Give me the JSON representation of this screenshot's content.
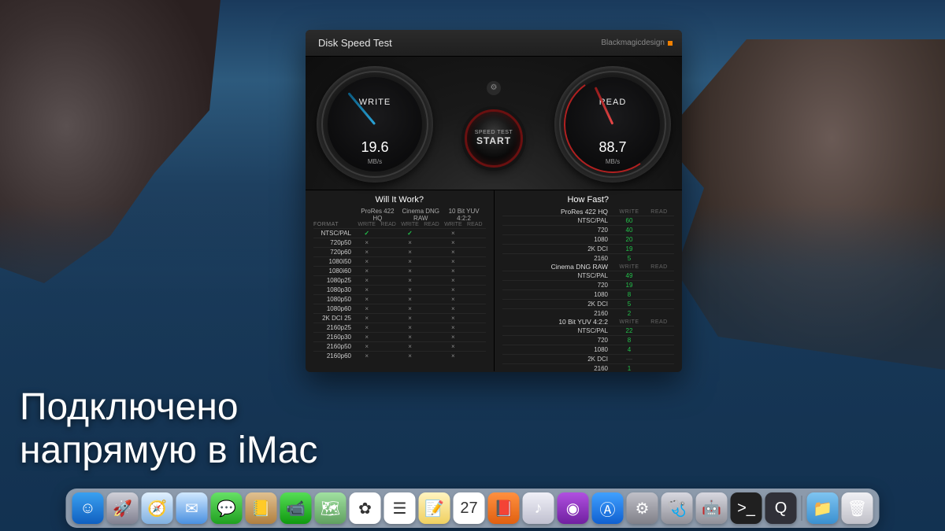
{
  "overlay": {
    "line1": "Подключено",
    "line2": "напрямую в iMac"
  },
  "app": {
    "title": "Disk Speed Test",
    "brand": "Blackmagicdesign",
    "write": {
      "label": "WRITE",
      "value": "19.6",
      "unit": "MB/s"
    },
    "read": {
      "label": "READ",
      "value": "88.7",
      "unit": "MB/s"
    },
    "start": {
      "line1": "SPEED TEST",
      "line2": "START"
    },
    "willItWork": {
      "title": "Will It Work?",
      "formatLabel": "FORMAT",
      "codecs": [
        "ProRes 422 HQ",
        "Cinema DNG RAW",
        "10 Bit YUV 4:2:2"
      ],
      "sub": [
        "WRITE",
        "READ"
      ],
      "rows": [
        {
          "fmt": "NTSC/PAL",
          "cells": [
            "✓",
            "",
            "✓",
            "",
            "×",
            ""
          ]
        },
        {
          "fmt": "720p50",
          "cells": [
            "×",
            "",
            "×",
            "",
            "×",
            ""
          ]
        },
        {
          "fmt": "720p60",
          "cells": [
            "×",
            "",
            "×",
            "",
            "×",
            ""
          ]
        },
        {
          "fmt": "1080i50",
          "cells": [
            "×",
            "",
            "×",
            "",
            "×",
            ""
          ]
        },
        {
          "fmt": "1080i60",
          "cells": [
            "×",
            "",
            "×",
            "",
            "×",
            ""
          ]
        },
        {
          "fmt": "1080p25",
          "cells": [
            "×",
            "",
            "×",
            "",
            "×",
            ""
          ]
        },
        {
          "fmt": "1080p30",
          "cells": [
            "×",
            "",
            "×",
            "",
            "×",
            ""
          ]
        },
        {
          "fmt": "1080p50",
          "cells": [
            "×",
            "",
            "×",
            "",
            "×",
            ""
          ]
        },
        {
          "fmt": "1080p60",
          "cells": [
            "×",
            "",
            "×",
            "",
            "×",
            ""
          ]
        },
        {
          "fmt": "2K DCI 25",
          "cells": [
            "×",
            "",
            "×",
            "",
            "×",
            ""
          ]
        },
        {
          "fmt": "2160p25",
          "cells": [
            "×",
            "",
            "×",
            "",
            "×",
            ""
          ]
        },
        {
          "fmt": "2160p30",
          "cells": [
            "×",
            "",
            "×",
            "",
            "×",
            ""
          ]
        },
        {
          "fmt": "2160p50",
          "cells": [
            "×",
            "",
            "×",
            "",
            "×",
            ""
          ]
        },
        {
          "fmt": "2160p60",
          "cells": [
            "×",
            "",
            "×",
            "",
            "×",
            ""
          ]
        }
      ]
    },
    "howFast": {
      "title": "How Fast?",
      "sub": [
        "WRITE",
        "READ"
      ],
      "groups": [
        {
          "codec": "ProRes 422 HQ",
          "rows": [
            {
              "fmt": "NTSC/PAL",
              "w": "60",
              "r": ""
            },
            {
              "fmt": "720",
              "w": "40",
              "r": ""
            },
            {
              "fmt": "1080",
              "w": "20",
              "r": ""
            },
            {
              "fmt": "2K DCI",
              "w": "19",
              "r": ""
            },
            {
              "fmt": "2160",
              "w": "5",
              "r": ""
            }
          ]
        },
        {
          "codec": "Cinema DNG RAW",
          "rows": [
            {
              "fmt": "NTSC/PAL",
              "w": "49",
              "r": ""
            },
            {
              "fmt": "720",
              "w": "19",
              "r": ""
            },
            {
              "fmt": "1080",
              "w": "8",
              "r": ""
            },
            {
              "fmt": "2K DCI",
              "w": "5",
              "r": ""
            },
            {
              "fmt": "2160",
              "w": "2",
              "r": ""
            }
          ]
        },
        {
          "codec": "10 Bit YUV 4:2:2",
          "rows": [
            {
              "fmt": "NTSC/PAL",
              "w": "22",
              "r": ""
            },
            {
              "fmt": "720",
              "w": "8",
              "r": ""
            },
            {
              "fmt": "1080",
              "w": "4",
              "r": ""
            },
            {
              "fmt": "2K DCI",
              "w": "—",
              "r": ""
            },
            {
              "fmt": "2160",
              "w": "1",
              "r": ""
            }
          ]
        }
      ]
    }
  },
  "dock": {
    "items": [
      {
        "name": "finder",
        "bg": "linear-gradient(#3aa0f0,#1060c0)",
        "glyph": "☺"
      },
      {
        "name": "launchpad",
        "bg": "linear-gradient(#d0d0d8,#808090)",
        "glyph": "🚀"
      },
      {
        "name": "safari",
        "bg": "linear-gradient(#e0f0ff,#80b0e0)",
        "glyph": "🧭"
      },
      {
        "name": "mail",
        "bg": "linear-gradient(#d0e8ff,#4a90e0)",
        "glyph": "✉"
      },
      {
        "name": "messages",
        "bg": "linear-gradient(#66e066,#20a020)",
        "glyph": "💬"
      },
      {
        "name": "contacts",
        "bg": "linear-gradient(#e0c090,#b08040)",
        "glyph": "📒"
      },
      {
        "name": "facetime",
        "bg": "linear-gradient(#55dd55,#109910)",
        "glyph": "📹"
      },
      {
        "name": "maps",
        "bg": "linear-gradient(#a0e0a0,#60a060)",
        "glyph": "🗺"
      },
      {
        "name": "photos",
        "bg": "#fff",
        "glyph": "✿"
      },
      {
        "name": "reminders",
        "bg": "#fff",
        "glyph": "☰"
      },
      {
        "name": "notes",
        "bg": "linear-gradient(#fff4c0,#f0d060)",
        "glyph": "📝"
      },
      {
        "name": "calendar",
        "bg": "#fff",
        "glyph": "27"
      },
      {
        "name": "books",
        "bg": "linear-gradient(#ff9040,#e06010)",
        "glyph": "📕"
      },
      {
        "name": "itunes",
        "bg": "linear-gradient(#f0f0f8,#c0c0d0)",
        "glyph": "♪"
      },
      {
        "name": "podcasts",
        "bg": "linear-gradient(#b050e0,#7020a0)",
        "glyph": "◉"
      },
      {
        "name": "appstore",
        "bg": "linear-gradient(#40a0ff,#1060d0)",
        "glyph": "Ⓐ"
      },
      {
        "name": "preferences",
        "bg": "linear-gradient(#c0c0c8,#808088)",
        "glyph": "⚙"
      },
      {
        "name": "utilities",
        "bg": "linear-gradient(#d8d8e0,#909098)",
        "glyph": "🩺"
      },
      {
        "name": "automator",
        "bg": "linear-gradient(#d8d8e0,#909098)",
        "glyph": "🤖"
      },
      {
        "name": "terminal",
        "bg": "#202020",
        "glyph": ">_"
      },
      {
        "name": "quicktime",
        "bg": "#303038",
        "glyph": "Q"
      }
    ],
    "sep_after": 20,
    "right": [
      {
        "name": "folder",
        "bg": "linear-gradient(#7fc4f0,#3a90d0)",
        "glyph": "📁"
      },
      {
        "name": "trash",
        "bg": "linear-gradient(#f0f0f4,#c0c0c8)",
        "glyph": "🗑"
      }
    ]
  }
}
